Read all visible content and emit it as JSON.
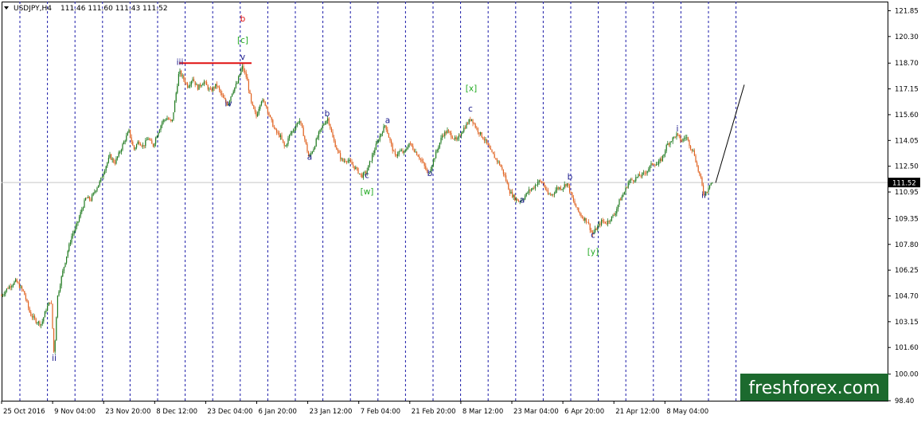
{
  "header": {
    "symbol": "USDJPY,H4",
    "ohlc": "111.46 111.60 111.43 111.52"
  },
  "watermark": "freshforex.com",
  "colors": {
    "bull": "#1f7a1f",
    "bear": "#e0611f",
    "grid": "#1a1aa8",
    "wave_blue": "#1a1a8c",
    "wave_green": "#22aa22",
    "wave_red": "#e01010",
    "watermark_bg": "#1c6a2e"
  },
  "chart_data": {
    "type": "candlestick",
    "ylim": [
      98.4,
      122.4
    ],
    "y_ticks": [
      "121.85",
      "120.30",
      "118.70",
      "117.15",
      "115.60",
      "114.05",
      "112.50",
      "110.95",
      "109.35",
      "107.80",
      "106.25",
      "104.70",
      "103.15",
      "101.60",
      "100.00",
      "98.40"
    ],
    "x_ticks": [
      "25 Oct 2016",
      "9 Nov 04:00",
      "23 Nov 20:00",
      "8 Dec 12:00",
      "23 Dec 04:00",
      "6 Jan 20:00",
      "23 Jan 12:00",
      "7 Feb 04:00",
      "21 Feb 20:00",
      "8 Mar 12:00",
      "23 Mar 04:00",
      "6 Apr 20:00",
      "21 Apr 12:00",
      "8 May 04:00"
    ],
    "current_price": "111.52",
    "price_path": [
      [
        0,
        104.6
      ],
      [
        10,
        105.2
      ],
      [
        20,
        105.6
      ],
      [
        30,
        104.9
      ],
      [
        38,
        103.6
      ],
      [
        45,
        103.2
      ],
      [
        52,
        103.0
      ],
      [
        58,
        103.9
      ],
      [
        64,
        104.5
      ],
      [
        68,
        101.0
      ],
      [
        72,
        104.6
      ],
      [
        78,
        106.0
      ],
      [
        84,
        107.2
      ],
      [
        90,
        108.3
      ],
      [
        96,
        108.9
      ],
      [
        102,
        109.8
      ],
      [
        108,
        110.6
      ],
      [
        114,
        110.5
      ],
      [
        120,
        111.1
      ],
      [
        126,
        111.6
      ],
      [
        132,
        112.4
      ],
      [
        138,
        113.1
      ],
      [
        144,
        112.7
      ],
      [
        150,
        113.3
      ],
      [
        156,
        114.0
      ],
      [
        162,
        114.6
      ],
      [
        168,
        113.5
      ],
      [
        174,
        114.0
      ],
      [
        180,
        113.7
      ],
      [
        186,
        114.2
      ],
      [
        192,
        113.7
      ],
      [
        198,
        114.5
      ],
      [
        204,
        115.2
      ],
      [
        210,
        115.4
      ],
      [
        216,
        115.1
      ],
      [
        220,
        116.5
      ],
      [
        225,
        118.2
      ],
      [
        230,
        117.8
      ],
      [
        236,
        117.3
      ],
      [
        242,
        117.8
      ],
      [
        248,
        117.2
      ],
      [
        256,
        117.6
      ],
      [
        264,
        117.0
      ],
      [
        272,
        117.4
      ],
      [
        280,
        116.6
      ],
      [
        286,
        116.2
      ],
      [
        292,
        117.0
      ],
      [
        298,
        117.5
      ],
      [
        304,
        118.5
      ],
      [
        310,
        117.8
      ],
      [
        316,
        116.2
      ],
      [
        322,
        115.5
      ],
      [
        328,
        116.5
      ],
      [
        334,
        116.2
      ],
      [
        340,
        115.3
      ],
      [
        346,
        114.6
      ],
      [
        352,
        114.3
      ],
      [
        358,
        113.6
      ],
      [
        364,
        114.4
      ],
      [
        370,
        114.8
      ],
      [
        376,
        115.3
      ],
      [
        382,
        114.3
      ],
      [
        388,
        113.0
      ],
      [
        394,
        113.6
      ],
      [
        400,
        114.4
      ],
      [
        406,
        115.0
      ],
      [
        412,
        115.4
      ],
      [
        418,
        114.2
      ],
      [
        424,
        113.4
      ],
      [
        430,
        112.8
      ],
      [
        436,
        112.9
      ],
      [
        442,
        112.6
      ],
      [
        448,
        112.3
      ],
      [
        454,
        111.9
      ],
      [
        460,
        112.1
      ],
      [
        466,
        112.9
      ],
      [
        472,
        113.7
      ],
      [
        478,
        114.4
      ],
      [
        484,
        115.0
      ],
      [
        490,
        114.0
      ],
      [
        496,
        113.1
      ],
      [
        502,
        113.4
      ],
      [
        508,
        113.3
      ],
      [
        514,
        113.9
      ],
      [
        520,
        113.5
      ],
      [
        526,
        113.1
      ],
      [
        532,
        112.6
      ],
      [
        538,
        112.0
      ],
      [
        544,
        112.8
      ],
      [
        550,
        113.6
      ],
      [
        556,
        114.4
      ],
      [
        562,
        114.6
      ],
      [
        568,
        114.3
      ],
      [
        574,
        114.0
      ],
      [
        580,
        114.6
      ],
      [
        586,
        115.0
      ],
      [
        592,
        115.4
      ],
      [
        598,
        114.8
      ],
      [
        604,
        114.4
      ],
      [
        610,
        114.0
      ],
      [
        616,
        113.4
      ],
      [
        622,
        113.0
      ],
      [
        628,
        112.6
      ],
      [
        634,
        111.9
      ],
      [
        640,
        111.0
      ],
      [
        646,
        110.6
      ],
      [
        652,
        110.4
      ],
      [
        658,
        110.6
      ],
      [
        664,
        111.0
      ],
      [
        670,
        111.2
      ],
      [
        676,
        111.6
      ],
      [
        682,
        111.5
      ],
      [
        688,
        110.8
      ],
      [
        694,
        110.8
      ],
      [
        700,
        111.2
      ],
      [
        706,
        111.2
      ],
      [
        712,
        111.5
      ],
      [
        716,
        111.0
      ],
      [
        720,
        110.4
      ],
      [
        726,
        109.8
      ],
      [
        732,
        109.4
      ],
      [
        738,
        109.2
      ],
      [
        744,
        108.4
      ],
      [
        750,
        108.8
      ],
      [
        756,
        109.2
      ],
      [
        762,
        109.1
      ],
      [
        768,
        109.4
      ],
      [
        772,
        109.6
      ],
      [
        778,
        110.4
      ],
      [
        784,
        110.9
      ],
      [
        790,
        111.6
      ],
      [
        796,
        111.7
      ],
      [
        802,
        111.9
      ],
      [
        808,
        112.0
      ],
      [
        814,
        112.3
      ],
      [
        820,
        112.7
      ],
      [
        826,
        112.6
      ],
      [
        832,
        113.0
      ],
      [
        838,
        113.8
      ],
      [
        844,
        114.1
      ],
      [
        850,
        114.4
      ],
      [
        856,
        114.0
      ],
      [
        862,
        114.3
      ],
      [
        868,
        113.6
      ],
      [
        872,
        113.3
      ],
      [
        876,
        112.4
      ],
      [
        880,
        111.8
      ],
      [
        884,
        110.8
      ],
      [
        888,
        111.0
      ],
      [
        892,
        111.5
      ],
      [
        896,
        111.5
      ]
    ],
    "projection": [
      [
        899,
        111.5
      ],
      [
        935,
        117.4
      ]
    ],
    "resistance_line": {
      "from": [
        225,
        118.7
      ],
      "to": [
        316,
        118.7
      ]
    },
    "wave_labels": [
      {
        "text": "b",
        "x": 305,
        "price": 121.2,
        "color": "red",
        "pos": "above"
      },
      {
        "text": "[c]",
        "x": 305,
        "price": 119.9,
        "color": "green",
        "pos": "above"
      },
      {
        "text": "v",
        "x": 305,
        "price": 118.9,
        "color": "blue",
        "pos": "above"
      },
      {
        "text": "iii",
        "x": 226,
        "price": 118.6,
        "color": "blue",
        "pos": "above"
      },
      {
        "text": "iv",
        "x": 287,
        "price": 116.1,
        "color": "blue",
        "pos": "below"
      },
      {
        "text": "ii",
        "x": 68,
        "price": 100.8,
        "color": "blue",
        "pos": "below"
      },
      {
        "text": "a",
        "x": 389,
        "price": 112.9,
        "color": "blue",
        "pos": "below"
      },
      {
        "text": "b",
        "x": 411,
        "price": 115.5,
        "color": "blue",
        "pos": "above"
      },
      {
        "text": "c",
        "x": 461,
        "price": 111.8,
        "color": "blue",
        "pos": "below"
      },
      {
        "text": "[w]",
        "x": 461,
        "price": 110.8,
        "color": "green",
        "pos": "below"
      },
      {
        "text": "a",
        "x": 487,
        "price": 115.1,
        "color": "blue",
        "pos": "above"
      },
      {
        "text": "b",
        "x": 540,
        "price": 111.9,
        "color": "blue",
        "pos": "below"
      },
      {
        "text": "[x]",
        "x": 592,
        "price": 117.0,
        "color": "green",
        "pos": "above"
      },
      {
        "text": "c",
        "x": 591,
        "price": 115.8,
        "color": "blue",
        "pos": "above"
      },
      {
        "text": "a",
        "x": 656,
        "price": 110.3,
        "color": "blue",
        "pos": "below"
      },
      {
        "text": "b",
        "x": 716,
        "price": 111.7,
        "color": "blue",
        "pos": "above"
      },
      {
        "text": "c",
        "x": 745,
        "price": 108.2,
        "color": "blue",
        "pos": "below"
      },
      {
        "text": "[y]",
        "x": 745,
        "price": 107.2,
        "color": "green",
        "pos": "below"
      },
      {
        "text": "i",
        "x": 851,
        "price": 114.6,
        "color": "blue",
        "pos": "above"
      },
      {
        "text": "ii",
        "x": 884,
        "price": 110.6,
        "color": "blue",
        "pos": "below"
      }
    ]
  }
}
